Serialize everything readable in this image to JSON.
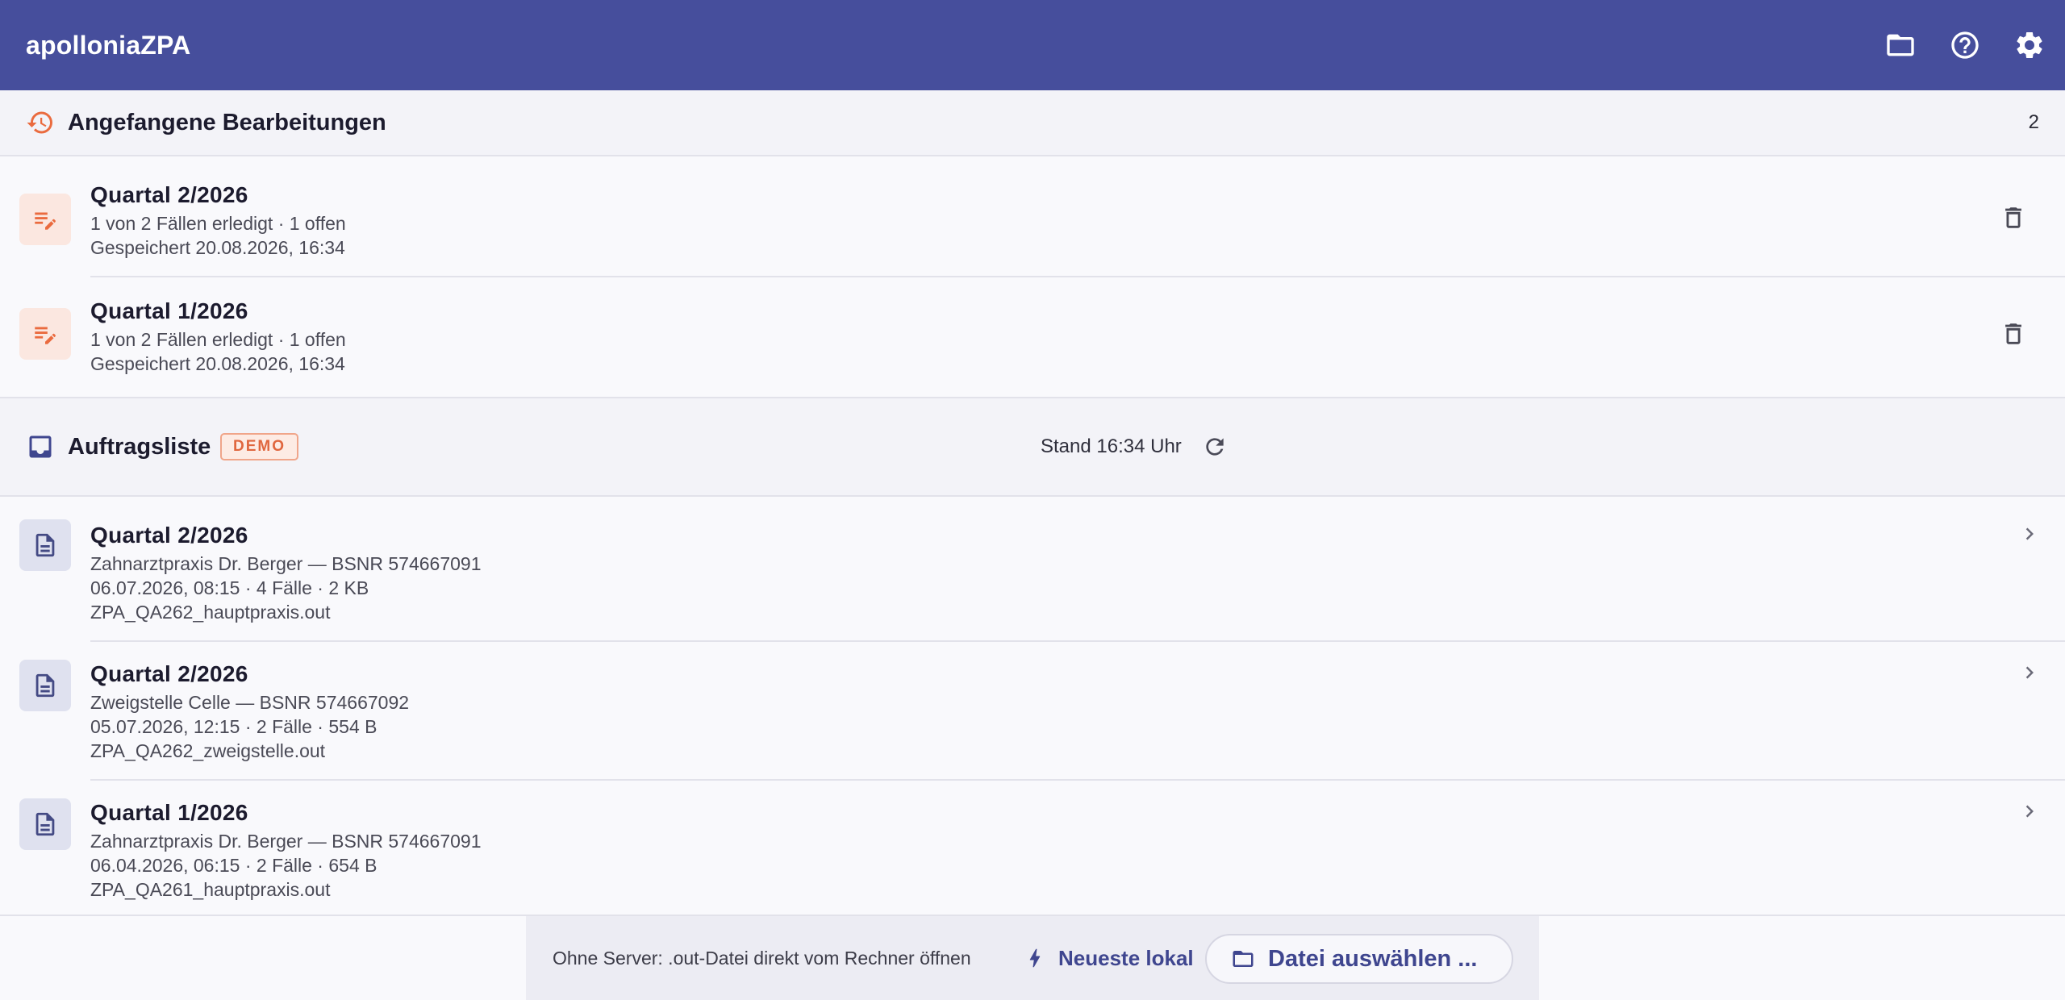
{
  "app": {
    "title": "apolloniaZPA"
  },
  "topbar": {
    "icons": [
      "folder-icon",
      "help-icon",
      "settings-icon"
    ]
  },
  "drafts": {
    "title": "Angefangene Bearbeitungen",
    "count": "2",
    "items": [
      {
        "title": "Quartal 2/2026",
        "progress": "1 von 2 Fällen erledigt  ·  1 offen",
        "saved": "Gespeichert 20.08.2026, 16:34"
      },
      {
        "title": "Quartal 1/2026",
        "progress": "1 von 2 Fällen erledigt  ·  1 offen",
        "saved": "Gespeichert 20.08.2026, 16:34"
      }
    ]
  },
  "orders": {
    "title": "Auftragsliste",
    "badge": "DEMO",
    "stand": "Stand 16:34 Uhr",
    "items": [
      {
        "title": "Quartal 2/2026",
        "practice": "Zahnarztpraxis Dr. Berger — BSNR 574667091",
        "meta": "06.07.2026, 08:15  ·  4 Fälle  ·  2 KB",
        "file": "ZPA_QA262_hauptpraxis.out"
      },
      {
        "title": "Quartal 2/2026",
        "practice": "Zweigstelle Celle — BSNR 574667092",
        "meta": "05.07.2026, 12:15  ·  2 Fälle  ·  554 B",
        "file": "ZPA_QA262_zweigstelle.out"
      },
      {
        "title": "Quartal 1/2026",
        "practice": "Zahnarztpraxis Dr. Berger — BSNR 574667091",
        "meta": "06.04.2026, 06:15  ·  2 Fälle  ·  654 B",
        "file": "ZPA_QA261_hauptpraxis.out"
      }
    ]
  },
  "footer": {
    "hint": "Ohne Server: .out-Datei direkt vom Rechner öffnen",
    "lokal_label": "Neueste lokal",
    "file_label": "Datei auswählen ..."
  },
  "colors": {
    "brand": "#464e9c",
    "accent": "#ea6b3f"
  }
}
